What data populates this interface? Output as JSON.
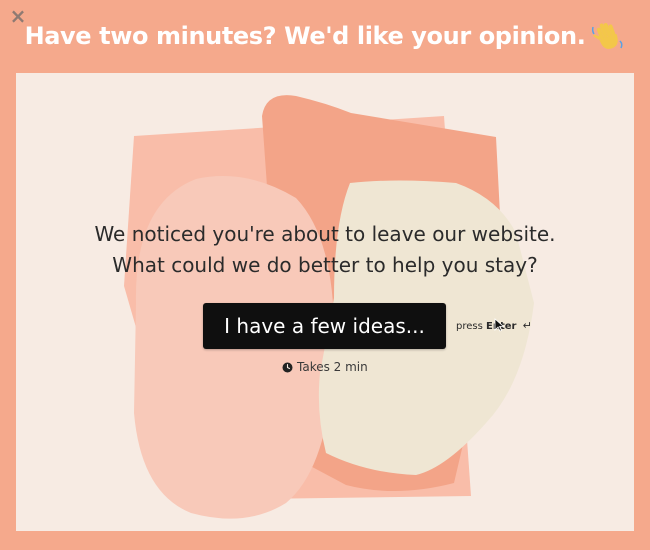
{
  "header": {
    "title": "Have two minutes? We'd like your opinion.",
    "icon": "waving-hand-icon",
    "close_label": "×"
  },
  "survey": {
    "question_line1": "We noticed you're about to leave our website.",
    "question_line2": "What could we do better to help you stay?",
    "cta_label": "I have a few ideas...",
    "press_label": "press",
    "key_label": "Enter",
    "enter_glyph": "↵",
    "duration_label": "Takes 2 min"
  },
  "colors": {
    "frame": "#f5a98c",
    "card": "#f7ebe3",
    "button": "#0f0f0f",
    "shape_salmon": "#f3a488",
    "shape_pink": "#f8c9b9",
    "shape_cream": "#efe6d3"
  }
}
